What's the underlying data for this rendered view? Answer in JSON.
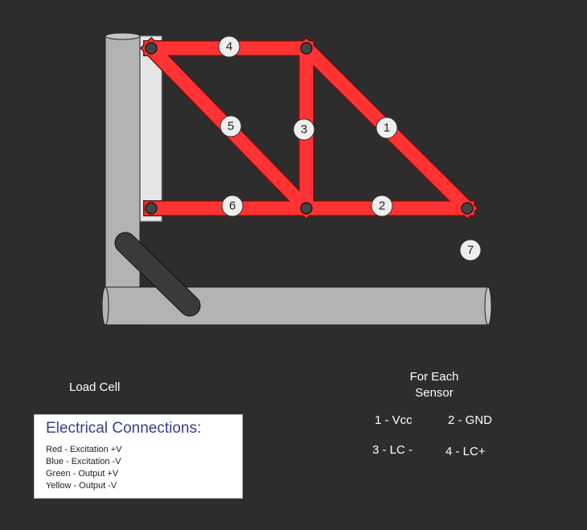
{
  "nodes": [
    {
      "id": "1",
      "label": "1"
    },
    {
      "id": "2",
      "label": "2"
    },
    {
      "id": "3",
      "label": "3"
    },
    {
      "id": "4",
      "label": "4"
    },
    {
      "id": "5",
      "label": "5"
    },
    {
      "id": "6",
      "label": "6"
    },
    {
      "id": "7",
      "label": "7"
    }
  ],
  "labels": {
    "load_cell": "Load Cell",
    "sensor_title": "For Each Sensor"
  },
  "pins": {
    "p1": "1 - Vcc",
    "p2": "2 - GND",
    "p3": "3 - LC -",
    "p4": "4 - LC+"
  },
  "connections": {
    "title": "Electrical Connections:",
    "lines": [
      "Red - Excitation +V",
      "Blue - Excitation -V",
      "Green - Output +V",
      "Yellow - Output -V"
    ]
  },
  "colors": {
    "background": "#2d2d2d",
    "member": "#ff3333",
    "pipe": "#b3b3b3",
    "load_cell": "#3a3a3a"
  }
}
